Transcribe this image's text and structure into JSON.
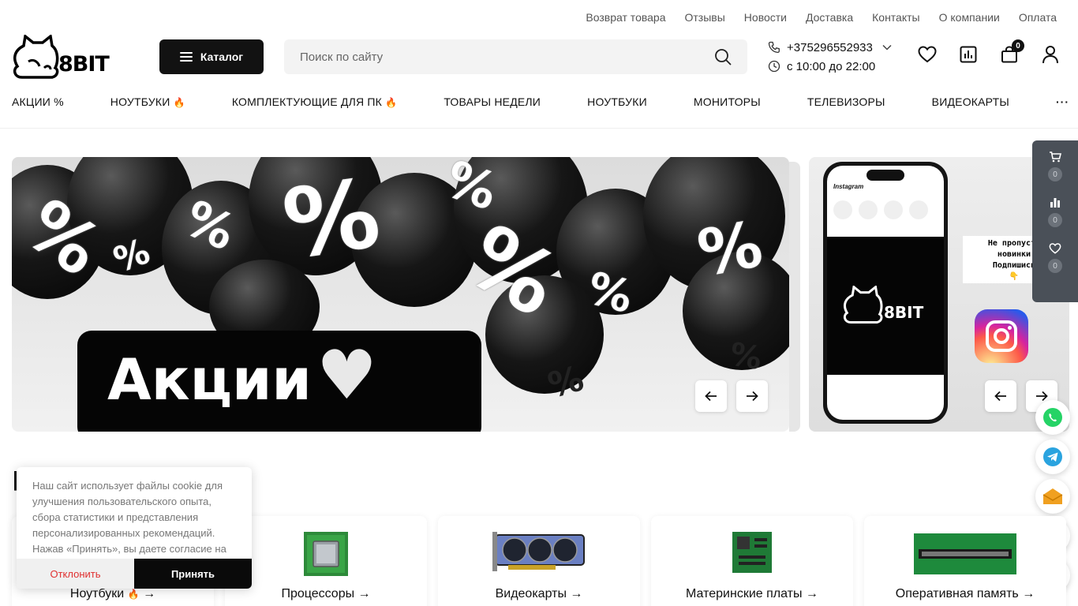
{
  "topbar": {
    "links": [
      "Возврат товара",
      "Отзывы",
      "Новости",
      "Доставка",
      "Контакты",
      "О компании",
      "Оплата"
    ]
  },
  "logo": {
    "text": "8BIT"
  },
  "catalog_button": {
    "label": "Каталог"
  },
  "search": {
    "placeholder": "Поиск по сайту"
  },
  "contact": {
    "phone": "+375296552933",
    "hours": "с 10:00 до 22:00"
  },
  "header": {
    "cart_count": "0"
  },
  "nav": {
    "items": [
      "АКЦИИ %",
      "НОУТБУКИ",
      "КОМПЛЕКТУЮЩИЕ ДЛЯ ПК",
      "ТОВАРЫ НЕДЕЛИ",
      "НОУТБУКИ",
      "МОНИТОРЫ",
      "ТЕЛЕВИЗОРЫ",
      "ВИДЕОКАРТЫ"
    ],
    "more": "···"
  },
  "banner_main": {
    "promo_text": "Акции"
  },
  "banner_side": {
    "sticker_line1": "Не пропусти",
    "sticker_line2": "новинки",
    "sticker_line3": "Подпишись",
    "phone_brand": "8BIT",
    "insta_title": "Instagram"
  },
  "side_panel": {
    "cart_count": "0",
    "compare_count": "0",
    "favorites_count": "0"
  },
  "cookie": {
    "text": "Наш сайт использует файлы cookie для улучшения пользовательского опыта, сбора статистики и представления персонализированных рекомендаций. Нажав «Принять», вы даете согласие на",
    "decline": "Отклонить",
    "accept": "Принять"
  },
  "categories": {
    "items": [
      "Ноутбуки",
      "Процессоры",
      "Видеокарты",
      "Материнские платы",
      "Оперативная память"
    ]
  },
  "colors": {
    "accent": "#121212",
    "flame": "#f07a10",
    "decline": "#e03030",
    "panel": "#4a5058"
  }
}
